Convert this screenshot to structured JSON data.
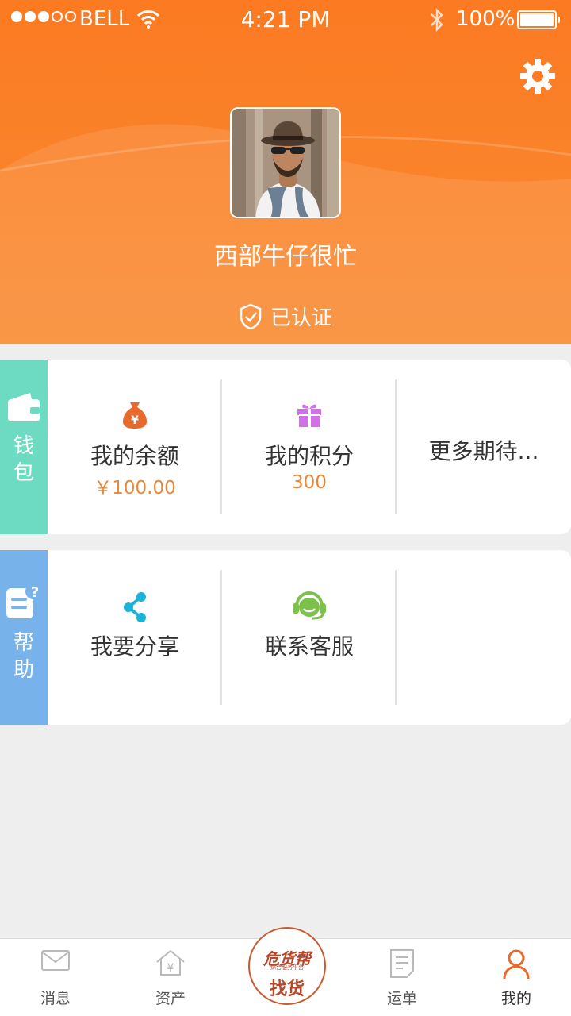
{
  "status_bar": {
    "carrier": "BELL",
    "time": "4:21 PM",
    "battery": "100%"
  },
  "profile": {
    "username": "西部牛仔很忙",
    "verified_label": "已认证"
  },
  "wallet": {
    "side_label_1": "钱",
    "side_label_2": "包",
    "items": [
      {
        "label": "我的余额",
        "value": "￥100.00",
        "icon": "money-bag-icon"
      },
      {
        "label": "我的积分",
        "value": "300",
        "icon": "gift-icon"
      },
      {
        "label": "更多期待..."
      }
    ]
  },
  "help": {
    "side_label_1": "帮",
    "side_label_2": "助",
    "items": [
      {
        "label": "我要分享",
        "icon": "share-icon"
      },
      {
        "label": "联系客服",
        "icon": "headset-icon"
      }
    ]
  },
  "tabbar": {
    "tabs": [
      {
        "label": "消息",
        "icon": "mail-icon"
      },
      {
        "label": "资产",
        "icon": "house-yen-icon"
      },
      {
        "label": "运单",
        "icon": "document-icon"
      },
      {
        "label": "我的",
        "icon": "person-icon"
      }
    ],
    "center": {
      "logo": "危货帮",
      "logo_sub": "综合服务平台",
      "label": "找货"
    }
  },
  "colors": {
    "header": "#fb7a22",
    "wallet_side": "#6ddbc1",
    "help_side": "#78b2ea",
    "value_text": "#e6873a",
    "active_tab": "#e8692c"
  }
}
